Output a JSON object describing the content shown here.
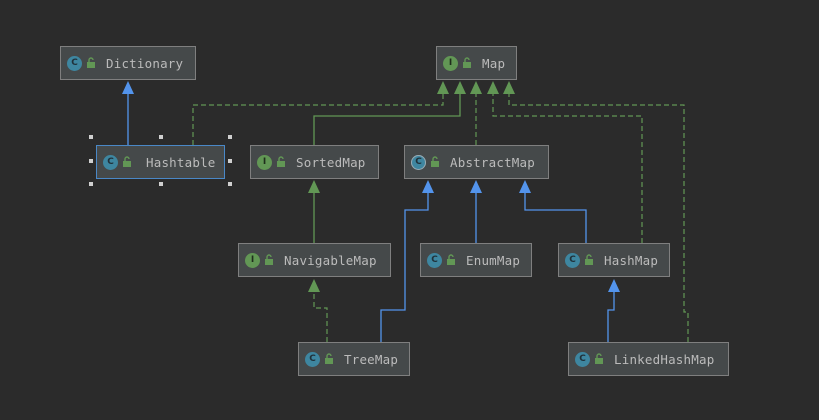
{
  "diagram": {
    "colors": {
      "background": "#2b2b2b",
      "extends_edge": "#5394ec",
      "implements_edge": "#629755",
      "class_badge": "#3e86a0",
      "interface_badge": "#629755",
      "node_fill": "#45494a",
      "node_border": "#7f7f7f",
      "selection": "#4a88c7"
    },
    "nodes": {
      "dictionary": {
        "label": "Dictionary",
        "kind": "class",
        "badge": "C"
      },
      "map": {
        "label": "Map",
        "kind": "interface",
        "badge": "I"
      },
      "hashtable": {
        "label": "Hashtable",
        "kind": "class",
        "badge": "C",
        "selected": true
      },
      "sortedmap": {
        "label": "SortedMap",
        "kind": "interface",
        "badge": "I"
      },
      "abstractmap": {
        "label": "AbstractMap",
        "kind": "abstract-class",
        "badge": "C"
      },
      "navigablemap": {
        "label": "NavigableMap",
        "kind": "interface",
        "badge": "I"
      },
      "enummap": {
        "label": "EnumMap",
        "kind": "class",
        "badge": "C"
      },
      "hashmap": {
        "label": "HashMap",
        "kind": "class",
        "badge": "C"
      },
      "treemap": {
        "label": "TreeMap",
        "kind": "class",
        "badge": "C"
      },
      "linkedhashmap": {
        "label": "LinkedHashMap",
        "kind": "class",
        "badge": "C"
      }
    },
    "edges": [
      {
        "from": "hashtable",
        "to": "dictionary",
        "type": "extends"
      },
      {
        "from": "hashtable",
        "to": "map",
        "type": "implements"
      },
      {
        "from": "sortedmap",
        "to": "map",
        "type": "extends-interface"
      },
      {
        "from": "abstractmap",
        "to": "map",
        "type": "implements"
      },
      {
        "from": "hashmap",
        "to": "map",
        "type": "implements"
      },
      {
        "from": "linkedhashmap",
        "to": "map",
        "type": "implements"
      },
      {
        "from": "navigablemap",
        "to": "sortedmap",
        "type": "extends-interface"
      },
      {
        "from": "treemap",
        "to": "navigablemap",
        "type": "implements"
      },
      {
        "from": "treemap",
        "to": "abstractmap",
        "type": "extends"
      },
      {
        "from": "enummap",
        "to": "abstractmap",
        "type": "extends"
      },
      {
        "from": "hashmap",
        "to": "abstractmap",
        "type": "extends"
      },
      {
        "from": "linkedhashmap",
        "to": "hashmap",
        "type": "extends"
      }
    ]
  }
}
